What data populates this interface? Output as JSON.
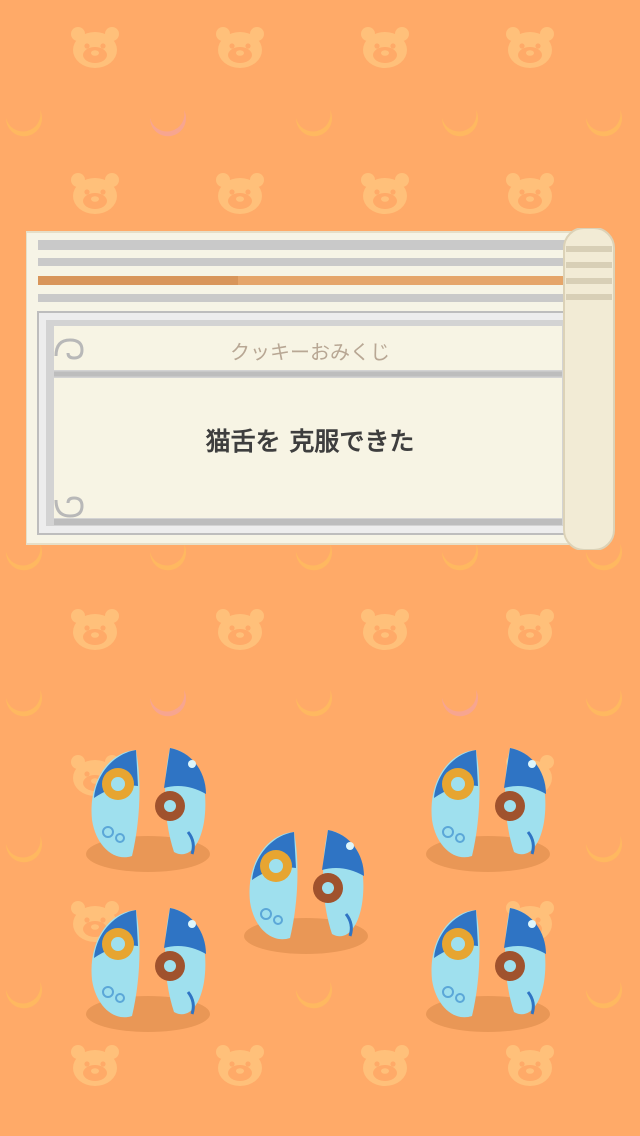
{
  "omikuji": {
    "title": "クッキーおみくじ",
    "fortune": "猫舌を 克服できた"
  },
  "cookies": {
    "count": 5,
    "icon": "split-fortune-cookie-with-gear-icon"
  },
  "colors": {
    "background": "#FFAA68",
    "pattern_bear": "#FFC07A",
    "pattern_crescent_orange": "#FFB46A",
    "pattern_crescent_pink": "#F7A590",
    "paper": "#F6F4E6",
    "frame": "#BDBDBD",
    "accent_stripe": "#E5A56A"
  }
}
